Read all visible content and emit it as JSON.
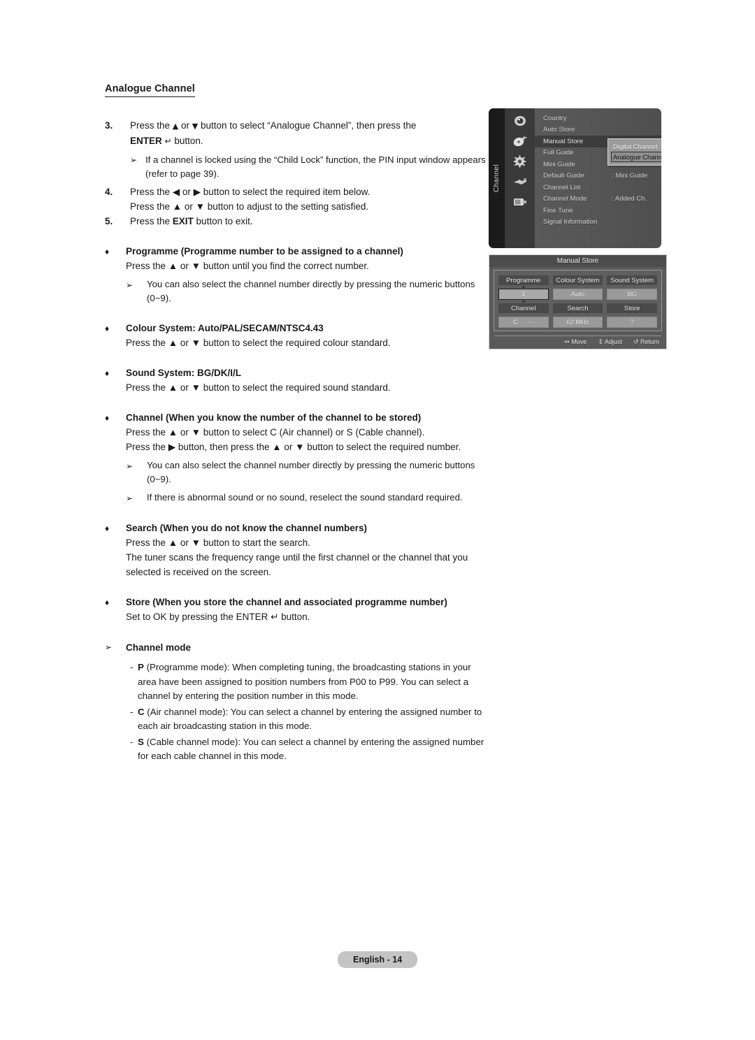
{
  "document": {
    "section_title": "Analogue Channel",
    "footer_label": "English - 14"
  },
  "steps": [
    {
      "num": "3.",
      "line1_a": "Press the ",
      "line1_up": "▲",
      "line1_b": " or ",
      "line1_down": "▼",
      "line1_c": " button to select “Analogue Channel”, then press the",
      "line2_bold": "ENTER",
      "line2_icon": "↵",
      "line2_rest": " button.",
      "note": {
        "marker": "➢",
        "text": "If a channel is locked using the “Child Lock” function, the PIN input window appears (refer to page 39)."
      }
    },
    {
      "num": "4.",
      "line1": "Press the ◀ or ▶ button to select the required item below.",
      "line2": "Press the ▲ or ▼ button to adjust to the setting satisfied."
    },
    {
      "num": "5.",
      "line1_a": "Press the ",
      "line1_bold": "EXIT",
      "line1_b": " button to exit."
    }
  ],
  "bullets": [
    {
      "marker": "♦",
      "heading": "Programme (Programme number to be assigned to a channel)",
      "lines": [
        "Press the ▲ or ▼ button until you find the correct number."
      ],
      "notes": [
        {
          "marker": "➢",
          "text": "You can also select the channel number directly by pressing the numeric buttons (0~9)."
        }
      ]
    },
    {
      "marker": "♦",
      "heading": "Colour System: Auto/PAL/SECAM/NTSC4.43",
      "lines": [
        "Press the ▲ or ▼ button to select the required colour standard."
      ],
      "notes": []
    },
    {
      "marker": "♦",
      "heading": "Sound System: BG/DK/I/L",
      "lines": [
        "Press the ▲ or ▼ button to select the required sound standard."
      ],
      "notes": []
    },
    {
      "marker": "♦",
      "heading": "Channel (When you know the number of the channel to be stored)",
      "lines": [
        "Press the ▲ or ▼ button to select C (Air channel) or S (Cable channel).",
        "Press the ▶ button, then press the ▲ or ▼ button to select the required number."
      ],
      "notes": [
        {
          "marker": "➢",
          "text": "You can also select the channel number directly by pressing the numeric buttons (0~9)."
        },
        {
          "marker": "➢",
          "text": "If there is abnormal sound or no sound, reselect the sound standard required."
        }
      ]
    },
    {
      "marker": "♦",
      "heading": "Search (When you do not know the channel numbers)",
      "lines": [
        "Press the ▲ or ▼ button to start the search.",
        "The tuner scans the frequency range until the first channel or the channel that you selected is received on the screen."
      ],
      "notes": []
    },
    {
      "marker": "♦",
      "heading": "Store (When you store the channel and associated programme number)",
      "lines": [
        "Set to OK by pressing the ENTER ↵ button."
      ],
      "notes": []
    }
  ],
  "channel_mode": {
    "marker": "➢",
    "heading": "Channel mode",
    "items": [
      {
        "dash": "-",
        "key": "P",
        "text": " (Programme mode): When completing tuning, the broadcasting stations in your area have been assigned to position numbers from P00 to P99. You can select a channel by entering the position number in this mode."
      },
      {
        "dash": "-",
        "key": "C",
        "text": " (Air channel mode): You can select a channel by entering the assigned number to each air broadcasting station in this mode."
      },
      {
        "dash": "-",
        "key": "S",
        "text": " (Cable channel mode): You can select a channel by entering the assigned number for each cable channel in this mode."
      }
    ]
  },
  "osd_menu": {
    "tab_label": "Channel",
    "icons": [
      "picture-icon",
      "satellite-dish-icon",
      "gear-icon",
      "plug-icon",
      "input-source-icon"
    ],
    "rows": [
      {
        "label": "Country",
        "value": "",
        "selected": false
      },
      {
        "label": "Auto Store",
        "value": "",
        "selected": false
      },
      {
        "label": "Manual Store",
        "value": "",
        "selected": true
      },
      {
        "label": "Full Guide",
        "value": "",
        "selected": false
      },
      {
        "label": "Mini Guide",
        "value": "",
        "selected": false
      },
      {
        "label": "Default Guide",
        "value": ": Mini Guide",
        "selected": false
      },
      {
        "label": "Channel List",
        "value": "",
        "selected": false
      },
      {
        "label": "Channel Mode",
        "value": ": Added Ch.",
        "selected": false
      },
      {
        "label": "Fine Tune",
        "value": "",
        "selected": false
      },
      {
        "label": "Signal Information",
        "value": "",
        "selected": false
      }
    ],
    "submenu": [
      {
        "label": "Digital Channel",
        "active": false
      },
      {
        "label": "Analogue Channel",
        "active": true
      }
    ]
  },
  "manual_store": {
    "title": "Manual Store",
    "fields": [
      {
        "header": "Programme",
        "value": "1",
        "focus": true
      },
      {
        "header": "Colour System",
        "value": "Auto",
        "focus": false
      },
      {
        "header": "Sound System",
        "value": "BG",
        "focus": false
      },
      {
        "header": "Channel",
        "value": "C",
        "value2": "- -",
        "focus": false
      },
      {
        "header": "Search",
        "value": "62 MHz",
        "focus": false
      },
      {
        "header": "Store",
        "value": "?",
        "focus": false
      }
    ],
    "hints": [
      {
        "icon": "⇔",
        "label": "Move"
      },
      {
        "icon": "⇕",
        "label": "Adjust"
      },
      {
        "icon": "↺",
        "label": "Return"
      }
    ]
  }
}
